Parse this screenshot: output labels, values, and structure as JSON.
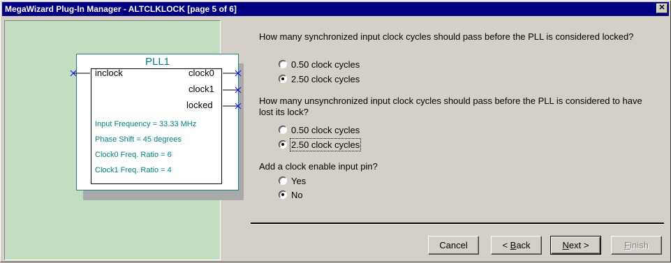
{
  "window": {
    "title": "MegaWizard Plug-In Manager - ALTCLKLOCK [page 5 of 6]",
    "close_glyph": "✕"
  },
  "diagram": {
    "block_name": "PLL1",
    "input_port": "inclock",
    "output_ports": [
      "clock0",
      "clock1",
      "locked"
    ],
    "parameters": [
      "Input Frequency = 33.33 MHz",
      "Phase Shift = 45 degrees",
      "Clock0 Freq. Ratio = 6",
      "Clock1 Freq. Ratio = 4"
    ],
    "pin_marker_color": "#0000ff",
    "param_color": "#008080",
    "background_color": "#c2ddbf"
  },
  "questions": [
    {
      "text": "How many synchronized input clock cycles should pass before the PLL is considered locked?",
      "options": [
        {
          "label": "0.50 clock cycles",
          "checked": false
        },
        {
          "label": "2.50 clock cycles",
          "checked": true
        }
      ]
    },
    {
      "text": "How many unsynchronized input clock cycles should pass before the PLL is considered to have lost its lock?",
      "options": [
        {
          "label": "0.50 clock cycles",
          "checked": false
        },
        {
          "label": "2.50 clock cycles",
          "checked": true
        }
      ]
    },
    {
      "text": "Add a clock enable input pin?",
      "options": [
        {
          "label": "Yes",
          "checked": false
        },
        {
          "label": "No",
          "checked": true
        }
      ]
    }
  ],
  "buttons": {
    "cancel": "Cancel",
    "back_prefix": "< ",
    "back_mnemonic": "B",
    "back_rest": "ack",
    "next_mnemonic": "N",
    "next_rest": "ext >",
    "finish_mnemonic": "F",
    "finish_rest": "inish"
  }
}
